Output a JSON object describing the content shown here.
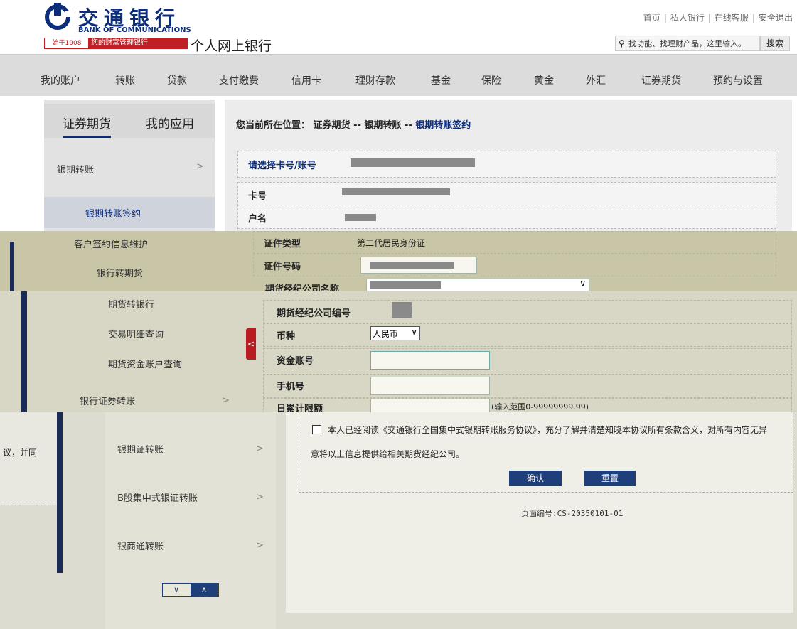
{
  "header": {
    "bank_name_cn": "交通银行",
    "bank_name_en": "BANK OF COMMUNICATIONS",
    "since": "始于1908",
    "slogan": "您的财富管理银行",
    "site_title": "个人网上银行",
    "top_links": [
      "首页",
      "私人银行",
      "在线客服",
      "安全退出"
    ],
    "search_placeholder": "找功能、找理财产品，这里输入。",
    "search_button": "搜索"
  },
  "nav": {
    "items": [
      "我的账户",
      "转账",
      "贷款",
      "支付缴费",
      "信用卡",
      "理财存款",
      "基金",
      "保险",
      "黄金",
      "外汇",
      "证券期货",
      "预约与设置"
    ]
  },
  "sidebar": {
    "tabs": [
      "证券期货",
      "我的应用"
    ],
    "group_top": "银期转账",
    "items_upper": [
      "银期转账签约",
      "客户签约信息维护",
      "银行转期货"
    ],
    "items_lower": [
      "期货转银行",
      "交易明细查询",
      "期货资金账户查询"
    ],
    "group_bank_sec": "银行证券转账",
    "groups_bottom": [
      "银期证转账",
      "B股集中式银证转账",
      "银商通转账"
    ]
  },
  "breadcrumb": {
    "prefix": "您当前所在位置：",
    "part1": "证券期货",
    "sep": "--",
    "part2": "银期转账",
    "part3": "银期转账签约"
  },
  "form": {
    "select_card_label": "请选择卡号/账号",
    "card_no_label": "卡号",
    "name_label": "户名",
    "id_type_label": "证件类型",
    "id_type_value": "第二代居民身份证",
    "id_no_label": "证件号码",
    "futures_company_label": "期货经纪公司名称",
    "futures_company_no_label": "期货经纪公司编号",
    "currency_label": "币种",
    "currency_value": "人民币",
    "fund_account_label": "资金账号",
    "mobile_label": "手机号",
    "daily_limit_label": "日累计限额",
    "daily_limit_hint": "(输入范围0-99999999.99)"
  },
  "agreement": {
    "line1": "本人已经阅读《交通银行全国集中式银期转账服务协议》，充分了解并清楚知晓本协议所有条款含义，对所有内容无异",
    "line2": "意将以上信息提供给相关期货经纪公司。",
    "left_fragment": "议，并同"
  },
  "buttons": {
    "confirm": "确认",
    "reset": "重置"
  },
  "page_id": "页面编号:CS-20350101-01",
  "colors": {
    "brand_blue": "#0c2d7a",
    "brand_red": "#c01f24"
  }
}
